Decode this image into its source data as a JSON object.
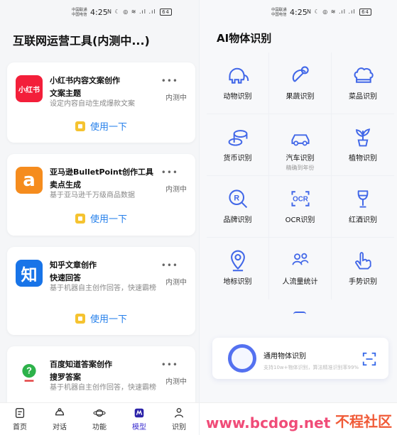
{
  "left_status": {
    "carrier_line_1": "中国联通",
    "carrier_line_2": "中国电信",
    "time": "4:25",
    "icons": "N ☾ ◎ ≋ .ıl .ıl",
    "battery": "64"
  },
  "right_status": {
    "carrier_line_1": "中国联通",
    "carrier_line_2": "中国电信",
    "time": "4:25",
    "icons": "N ☾ ◎ ≋ .ıl .ıl",
    "battery": "64"
  },
  "left_page": {
    "title": "互联网运营工具(内测中...)",
    "cards": [
      {
        "icon_text": "小红书",
        "name": "小红书内容文案创作",
        "subtitle": "文案主题",
        "description": "设定内容自动生成爆款文案",
        "status": "内测中",
        "action": "使用一下",
        "icon_color": "#f31f3a"
      },
      {
        "icon_text": "a",
        "name": "亚马逊BulletPoint创作工具",
        "subtitle": "卖点生成",
        "description": "基于亚马逊千万级商品数据",
        "status": "内测中",
        "action": "使用一下",
        "icon_color": "#f58c1e"
      },
      {
        "icon_text": "知",
        "name": "知乎文章创作",
        "subtitle": "快速回答",
        "description": "基于机器自主创作回答，快速霸榜",
        "status": "内测中",
        "action": "使用一下",
        "icon_color": "#1874e8"
      },
      {
        "icon_text": "?",
        "name": "百度知道答案创作",
        "subtitle": "搜罗答案",
        "description": "基于机器自主创作回答，快速霸榜",
        "status": "内测中",
        "icon_color": "#fff"
      }
    ],
    "nav": [
      "首页",
      "对话",
      "功能",
      "模型",
      "识别"
    ]
  },
  "right_page": {
    "title": "AI物体识别",
    "items": [
      {
        "label": "动物识别",
        "icon": "elephant-icon"
      },
      {
        "label": "果蔬识别",
        "icon": "vegetable-icon"
      },
      {
        "label": "菜品识别",
        "icon": "chef-hat-icon"
      },
      {
        "label": "货币识别",
        "icon": "coins-icon"
      },
      {
        "label": "汽车识别",
        "sub": "精确到年份",
        "icon": "car-icon"
      },
      {
        "label": "植物识别",
        "icon": "plant-icon"
      },
      {
        "label": "品牌识别",
        "icon": "brand-icon"
      },
      {
        "label": "OCR识别",
        "icon": "ocr-icon"
      },
      {
        "label": "红酒识别",
        "icon": "wine-icon"
      },
      {
        "label": "地标识别",
        "icon": "landmark-pin-icon"
      },
      {
        "label": "人流量统计",
        "icon": "people-icon"
      },
      {
        "label": "手势识别",
        "icon": "hand-gesture-icon"
      }
    ],
    "general": {
      "title": "通用物体识别",
      "description": "支持10w+物体识别，算法精准识别率99%"
    },
    "watermark": {
      "url": "www.bcdog.net",
      "label": "不程社区"
    }
  }
}
